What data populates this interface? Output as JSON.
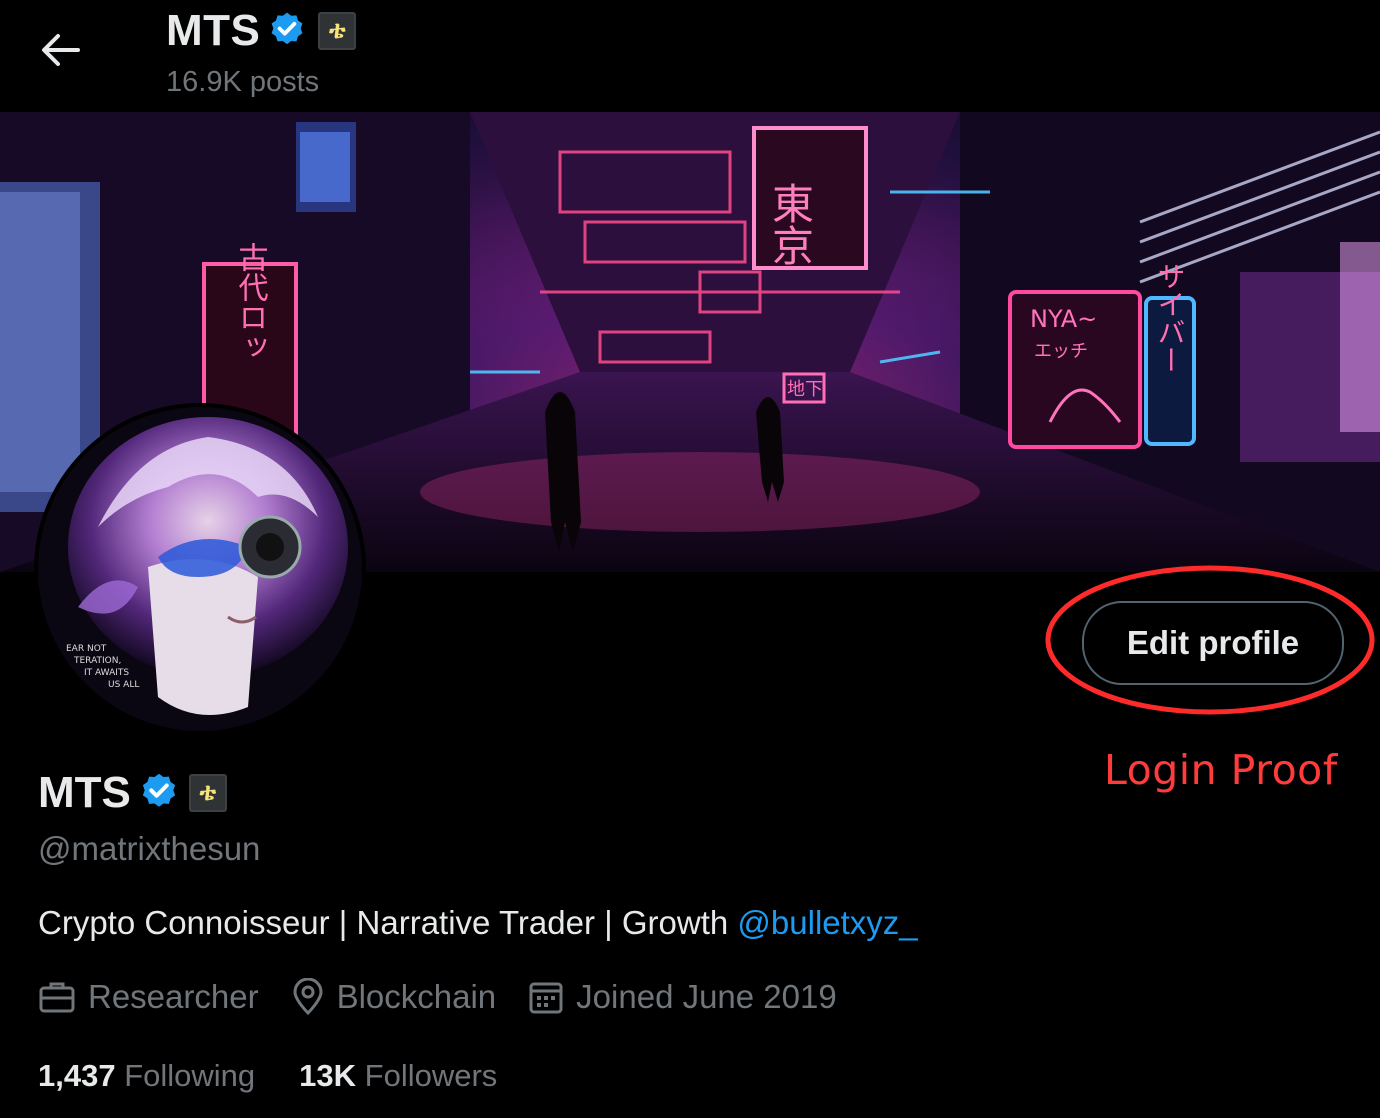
{
  "header": {
    "name": "MTS",
    "posts": "16.9K posts",
    "affiliate_glyph": "ቴ"
  },
  "profile": {
    "name": "MTS",
    "handle": "@matrixthesun",
    "bio_text": "Crypto Connoisseur | Narrative Trader | Growth ",
    "bio_mention": "@bulletxyz_",
    "meta": {
      "profession": "Researcher",
      "location": "Blockchain",
      "joined": "Joined June 2019"
    },
    "stats": {
      "following_count": "1,437",
      "following_label": "Following",
      "followers_count": "13K",
      "followers_label": "Followers"
    }
  },
  "actions": {
    "edit_profile": "Edit profile"
  },
  "annotation": {
    "label": "Login Proof",
    "color": "#ff3b3b"
  },
  "banner_signs": {
    "sign1": "古代ロッ",
    "sign2": "東京",
    "sign3": "NYA~",
    "sign4": "エッチ",
    "sign5": "サイバー",
    "sign6": "地下"
  },
  "avatar_text": {
    "line1": "EAR NOT",
    "line2": "TERATION,",
    "line3": "IT AWAITS",
    "line4": "US ALL"
  },
  "colors": {
    "background": "#000000",
    "text_primary": "#e7e9ea",
    "text_secondary": "#71767b",
    "link": "#1d9bf0",
    "verified": "#1d9bf0"
  },
  "icons": {
    "back": "arrow-left-icon",
    "verified": "verified-badge-icon",
    "profession": "briefcase-icon",
    "location": "location-pin-icon",
    "joined": "calendar-icon"
  }
}
